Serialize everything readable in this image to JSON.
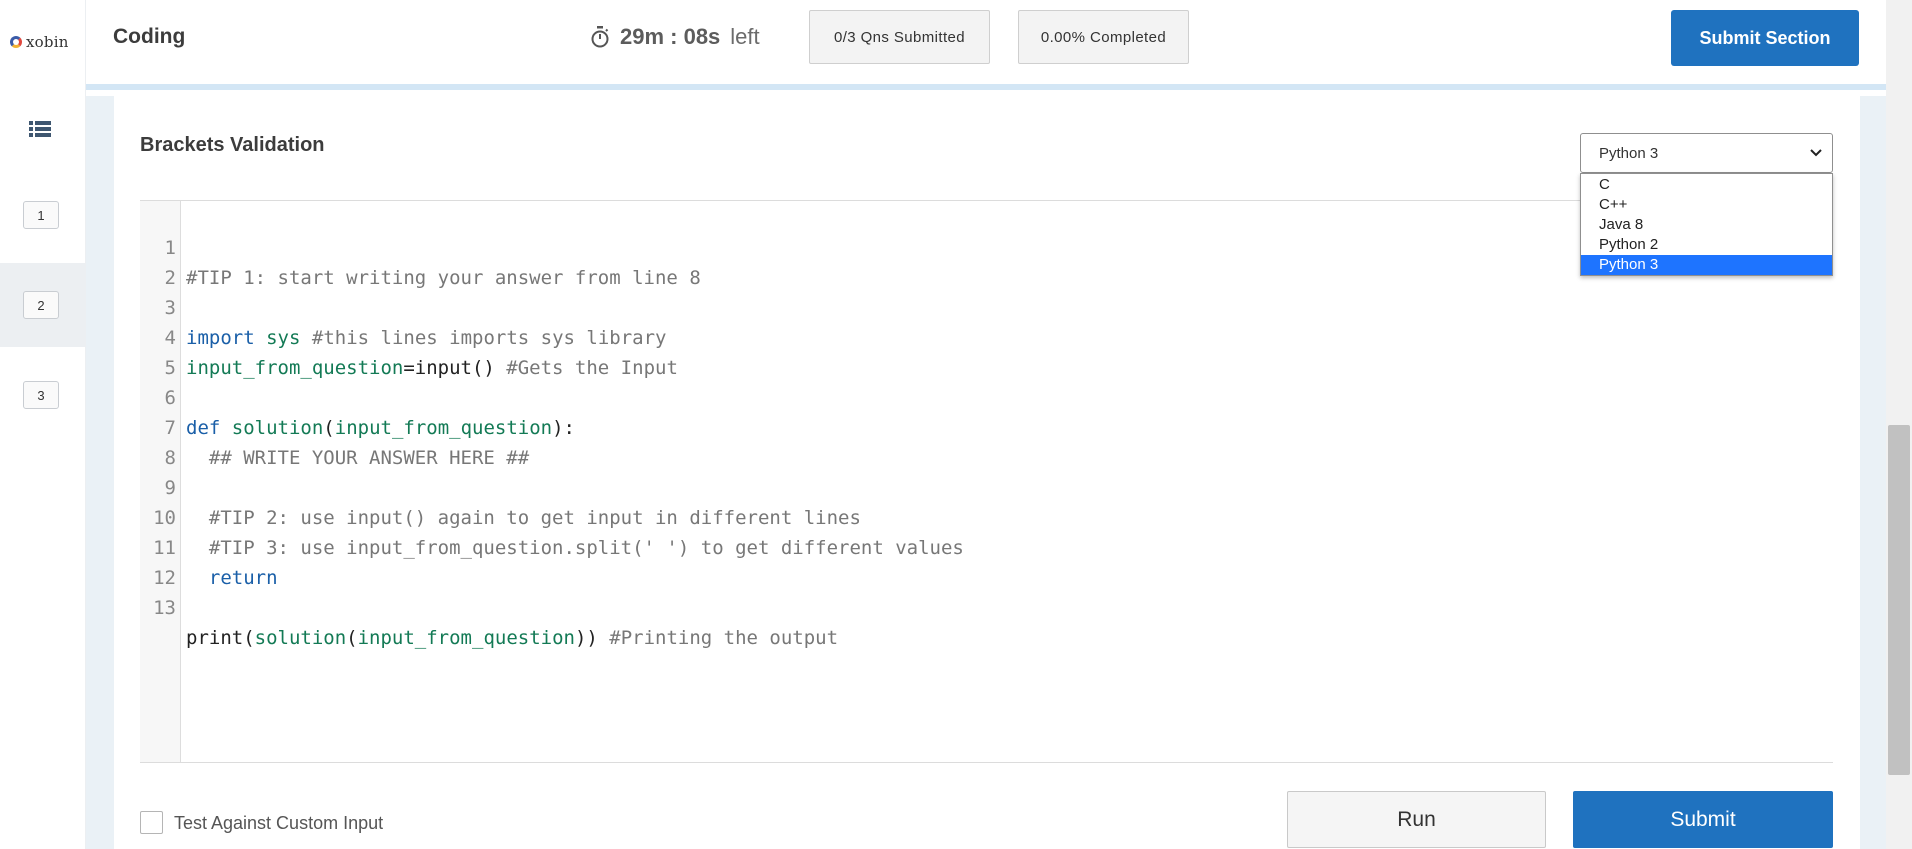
{
  "app": {
    "logo_text": "xobin"
  },
  "header": {
    "section_title": "Coding",
    "timer_value": "29m : 08s",
    "timer_suffix": "left",
    "submitted_label": "0/3 Qns Submitted",
    "completed_label": "0.00% Completed",
    "submit_section_label": "Submit Section"
  },
  "sidebar": {
    "questions": [
      {
        "label": "1",
        "active": false
      },
      {
        "label": "2",
        "active": true
      },
      {
        "label": "3",
        "active": false
      }
    ]
  },
  "question": {
    "title": "Brackets Validation"
  },
  "language": {
    "selected": "Python 3",
    "options": [
      "C",
      "C++",
      "Java 8",
      "Python 2",
      "Python 3"
    ]
  },
  "editor": {
    "lines": [
      {
        "num": "1",
        "text": "#TIP 1: start writing your answer from line 8"
      },
      {
        "num": "2",
        "text": ""
      },
      {
        "num": "3",
        "text": "import sys #this lines imports sys library"
      },
      {
        "num": "4",
        "text": "input_from_question=input() #Gets the Input"
      },
      {
        "num": "5",
        "text": ""
      },
      {
        "num": "6",
        "text": "def solution(input_from_question):"
      },
      {
        "num": "7",
        "text": "  ## WRITE YOUR ANSWER HERE ##"
      },
      {
        "num": "8",
        "text": ""
      },
      {
        "num": "9",
        "text": "  #TIP 2: use input() again to get input in different lines"
      },
      {
        "num": "10",
        "text": "  #TIP 3: use input_from_question.split(' ') to get different values"
      },
      {
        "num": "11",
        "text": "  return"
      },
      {
        "num": "12",
        "text": ""
      },
      {
        "num": "13",
        "text": "print(solution(input_from_question)) #Printing the output"
      }
    ]
  },
  "footer": {
    "custom_input_label": "Test Against Custom Input",
    "custom_input_checked": false,
    "run_label": "Run",
    "submit_label": "Submit"
  },
  "colors": {
    "primary": "#1f72bf",
    "selected_option": "#1e74ff",
    "header_border": "#d3e6f5",
    "sidebar_active": "#eceff2"
  },
  "icons": {
    "timer": "stopwatch-icon",
    "question_list": "list-icon",
    "select_caret": "chevron-down-icon"
  }
}
